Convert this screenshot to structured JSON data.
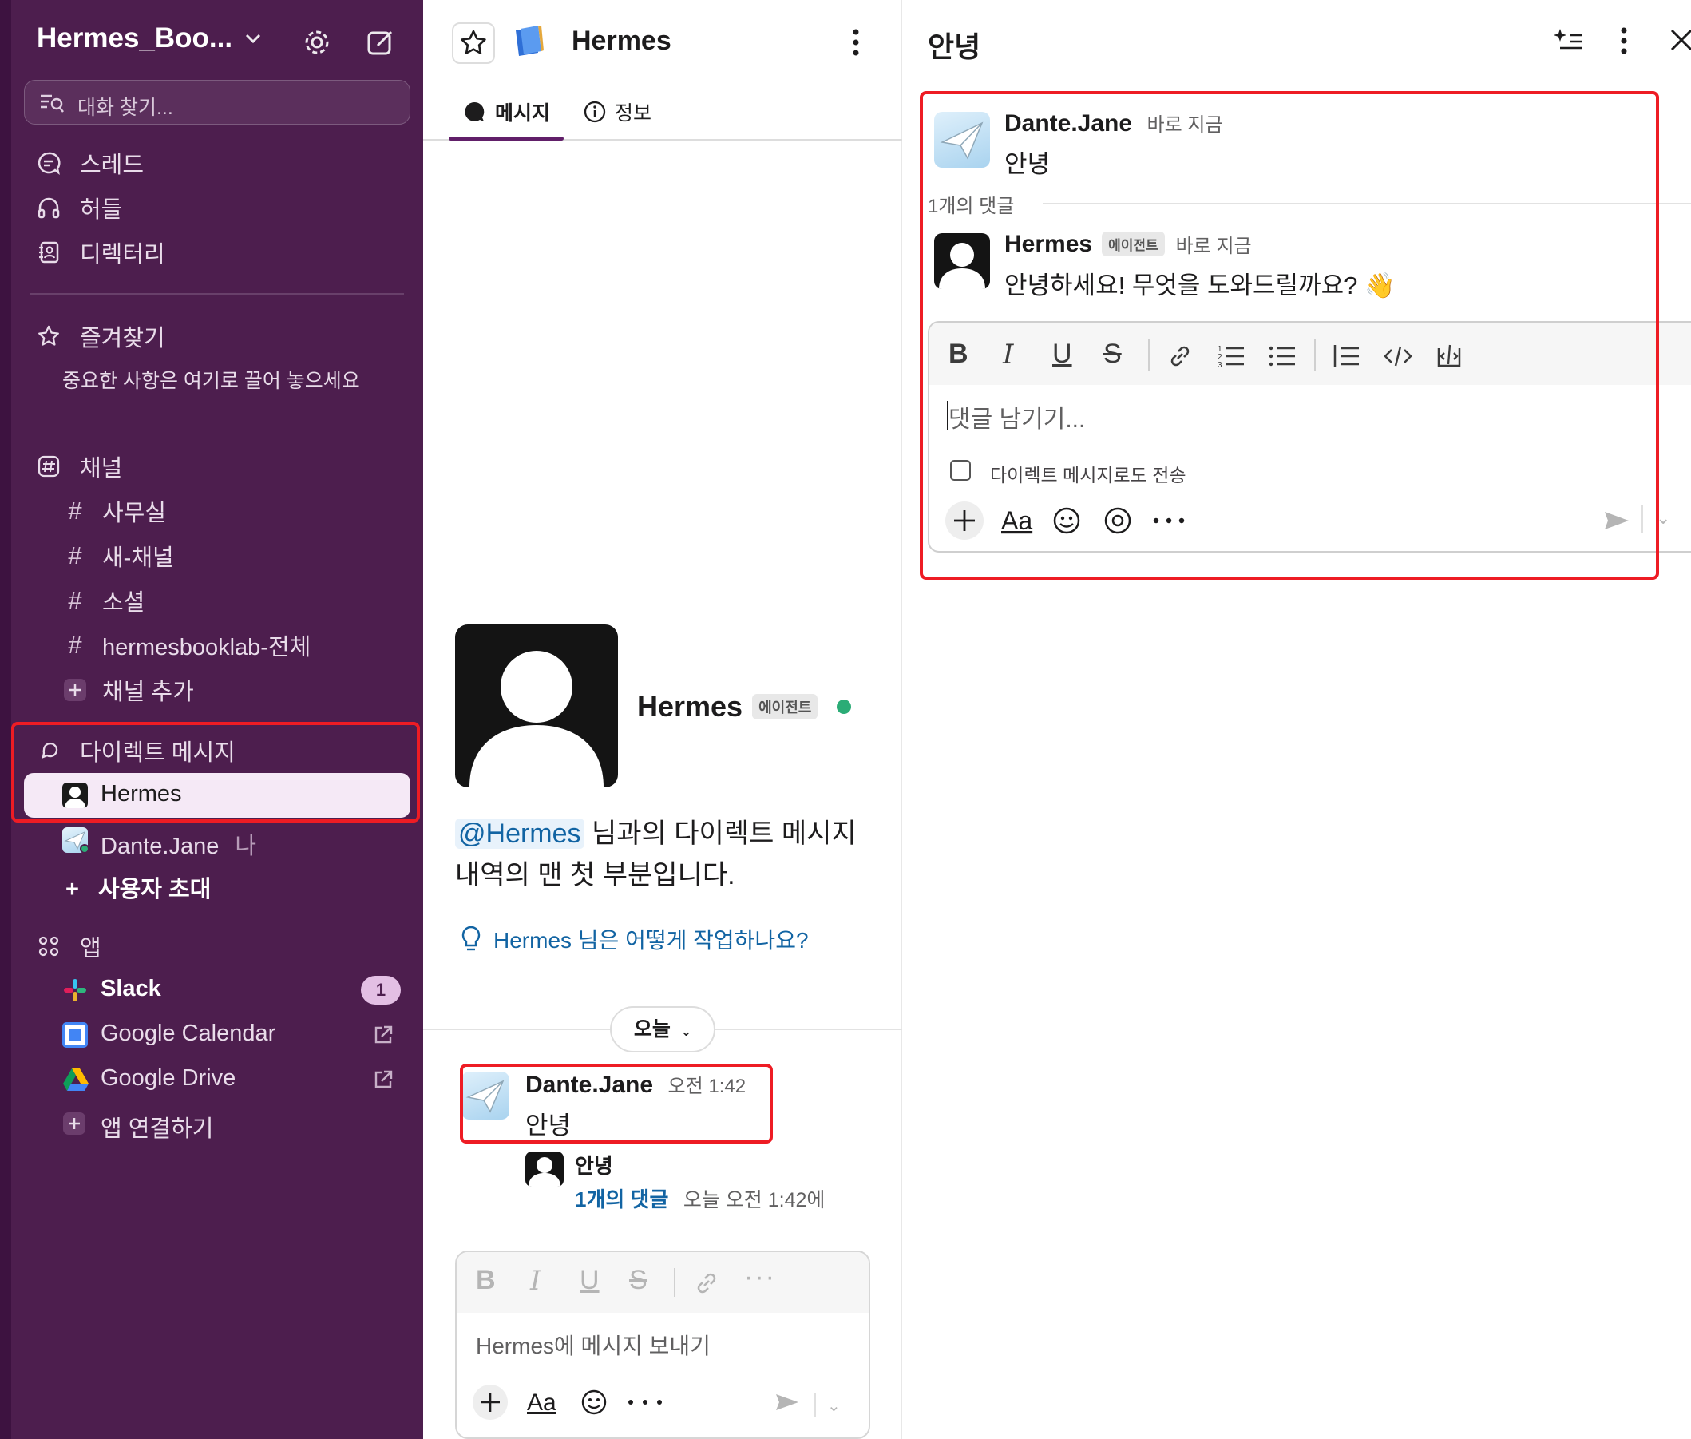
{
  "sidebar": {
    "workspace_name": "Hermes_Boo...",
    "search_placeholder": "대화 찾기...",
    "nav": [
      {
        "label": "스레드",
        "icon": "threads-icon"
      },
      {
        "label": "허들",
        "icon": "headphones-icon"
      },
      {
        "label": "디렉터리",
        "icon": "directory-icon"
      }
    ],
    "favorites": {
      "label": "즐겨찾기",
      "hint": "중요한 사항은 여기로 끌어 놓으세요"
    },
    "channels": {
      "label": "채널",
      "items": [
        "사무실",
        "새-채널",
        "소셜",
        "hermesbooklab-전체"
      ],
      "add": "채널 추가"
    },
    "direct_messages": {
      "label": "다이렉트 메시지",
      "items": [
        {
          "name": "Hermes",
          "suffix": ""
        },
        {
          "name": "Dante.Jane",
          "suffix": "나"
        }
      ],
      "invite": "사용자 초대"
    },
    "apps": {
      "label": "앱",
      "items": [
        {
          "name": "Slack",
          "badge": "1"
        },
        {
          "name": "Google Calendar"
        },
        {
          "name": "Google Drive"
        }
      ],
      "add": "앱 연결하기"
    }
  },
  "middle": {
    "title": "Hermes",
    "tabs": [
      {
        "label": "메시지",
        "active": true
      },
      {
        "label": "정보",
        "active": false
      }
    ],
    "profile_name": "Hermes",
    "agent_tag": "에이전트",
    "intro_mention": "@Hermes",
    "intro_text_1": " 님과의 다이렉트 메시지",
    "intro_text_2": "내역의 맨 첫 부분입니다.",
    "help_link": "Hermes 님은 어떻게 작업하나요?",
    "day_label": "오늘",
    "message": {
      "author": "Dante.Jane",
      "time": "오전 1:42",
      "text": "안녕"
    },
    "reply_preview": {
      "text": "안녕",
      "count": "1개의 댓글",
      "when": "오늘 오전 1:42에"
    },
    "composer_placeholder": "Hermes에 메시지 보내기"
  },
  "thread": {
    "title": "안녕",
    "root": {
      "author": "Dante.Jane",
      "time": "바로 지금",
      "text": "안녕"
    },
    "reply_count": "1개의 댓글",
    "reply": {
      "author": "Hermes",
      "tag": "에이전트",
      "time": "바로 지금",
      "text": "안녕하세요! 무엇을 도와드릴까요? 👋"
    },
    "composer_placeholder": "댓글 남기기...",
    "also_send_dm": "다이렉트 메시지로도 전송"
  },
  "colors": {
    "sidebar_bg": "#4d1e4e",
    "selected_bg": "#f5e9f6",
    "link": "#1264a3",
    "highlight_box": "#ee1c24",
    "presence": "#2bac76"
  }
}
